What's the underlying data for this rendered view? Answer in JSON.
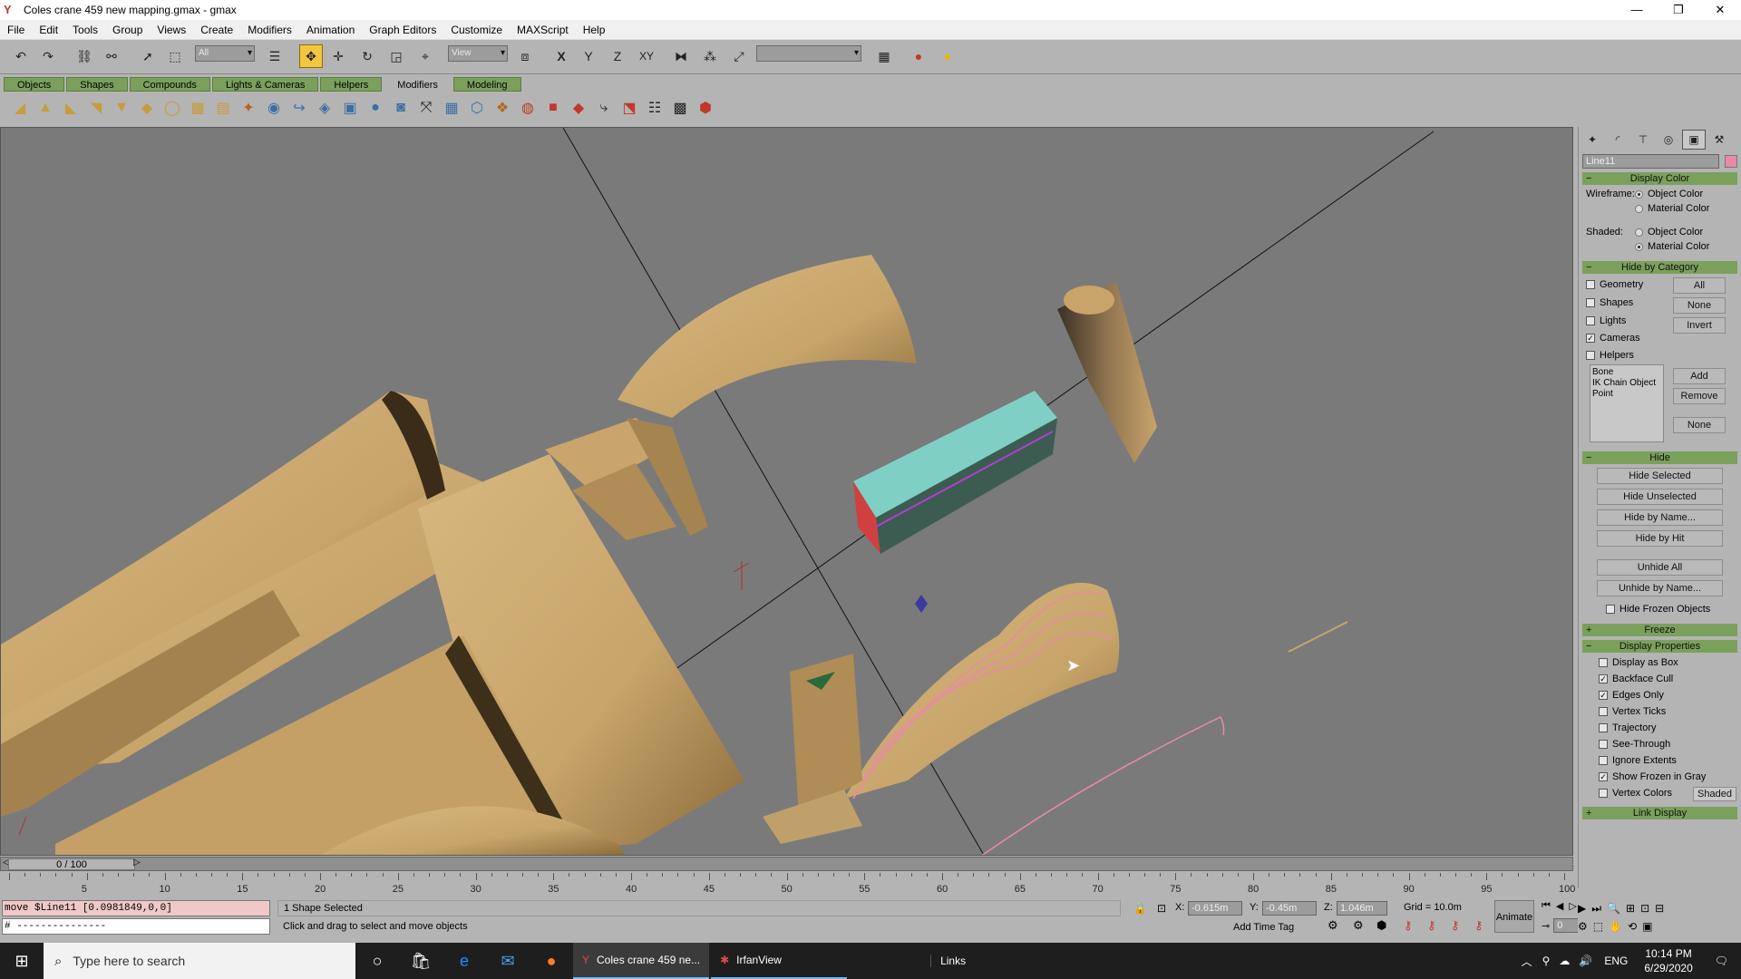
{
  "window": {
    "title": "Coles crane 459 new mapping.gmax - gmax",
    "controls": [
      "—",
      "❐",
      "✕"
    ]
  },
  "menu": [
    "File",
    "Edit",
    "Tools",
    "Group",
    "Views",
    "Create",
    "Modifiers",
    "Animation",
    "Graph Editors",
    "Customize",
    "MAXScript",
    "Help"
  ],
  "toolbar": {
    "selection_filter": "All",
    "ref_coord": "View",
    "axis_x": "X",
    "axis_y": "Y",
    "axis_z": "Z",
    "axis_xy": "XY"
  },
  "tabs": [
    "Objects",
    "Shapes",
    "Compounds",
    "Lights & Cameras",
    "Helpers",
    "Modifiers",
    "Modeling"
  ],
  "active_tab": "Modifiers",
  "command_panel": {
    "object_name": "Line11",
    "object_color": "#e98aa8",
    "display_color": {
      "header": "Display Color",
      "wireframe_label": "Wireframe:",
      "shaded_label": "Shaded:",
      "object_color": "Object Color",
      "material_color": "Material Color"
    },
    "hide_by_category": {
      "header": "Hide by Category",
      "items": [
        {
          "label": "Geometry",
          "checked": false
        },
        {
          "label": "Shapes",
          "checked": false
        },
        {
          "label": "Lights",
          "checked": false
        },
        {
          "label": "Cameras",
          "checked": true
        },
        {
          "label": "Helpers",
          "checked": false
        }
      ],
      "all": "All",
      "none": "None",
      "invert": "Invert",
      "list": [
        "Bone",
        "IK Chain Object",
        "Point"
      ],
      "add": "Add",
      "remove": "Remove",
      "none2": "None"
    },
    "hide": {
      "header": "Hide",
      "hide_selected": "Hide Selected",
      "hide_unselected": "Hide Unselected",
      "hide_by_name": "Hide by Name...",
      "hide_by_hit": "Hide by Hit",
      "unhide_all": "Unhide All",
      "unhide_by_name": "Unhide by Name...",
      "hide_frozen": "Hide Frozen Objects"
    },
    "freeze": {
      "header": "Freeze",
      "sign": "+"
    },
    "display_properties": {
      "header": "Display Properties",
      "items": [
        {
          "label": "Display as Box",
          "checked": false
        },
        {
          "label": "Backface Cull",
          "checked": true
        },
        {
          "label": "Edges Only",
          "checked": true
        },
        {
          "label": "Vertex Ticks",
          "checked": false
        },
        {
          "label": "Trajectory",
          "checked": false
        },
        {
          "label": "See-Through",
          "checked": false
        },
        {
          "label": "Ignore Extents",
          "checked": false
        },
        {
          "label": "Show Frozen in Gray",
          "checked": true
        },
        {
          "label": "Vertex Colors",
          "checked": false
        }
      ],
      "shaded_btn": "Shaded"
    },
    "link_display": {
      "header": "Link Display",
      "sign": "+"
    }
  },
  "timeline": {
    "frame": "0 / 100",
    "ticks": [
      "0",
      "5",
      "10",
      "15",
      "20",
      "25",
      "30",
      "35",
      "40",
      "45",
      "50",
      "55",
      "60",
      "65",
      "70",
      "75",
      "80",
      "85",
      "90",
      "95",
      "100"
    ]
  },
  "status": {
    "maxscript_line": "move $Line11 [0.0981849,0,0]",
    "maxscript_input": "# ---------------",
    "selection": "1 Shape Selected",
    "prompt": "Click and drag to select and move objects",
    "x_label": "X:",
    "x": "-0.615m",
    "y_label": "Y:",
    "y": "-0.45m",
    "z_label": "Z:",
    "z": "1.046m",
    "grid": "Grid = 10.0m",
    "add_time_tag": "Add Time Tag",
    "animate": "Animate",
    "frame_field": "0"
  },
  "taskbar": {
    "search_placeholder": "Type here to search",
    "apps": [
      {
        "label": "Coles crane 459 ne...",
        "icon": "gmax-icon"
      },
      {
        "label": "IrfanView",
        "icon": "irfanview-icon"
      }
    ],
    "links": "Links",
    "lang": "ENG",
    "time": "10:14 PM",
    "date": "6/29/2020"
  }
}
